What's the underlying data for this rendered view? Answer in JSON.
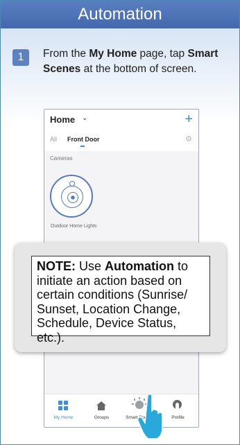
{
  "header": {
    "title": "Automation"
  },
  "step": {
    "number": "1",
    "text_1": "From the ",
    "bold_1": "My Home",
    "text_2": " page, tap ",
    "bold_2": "Smart Scenes",
    "text_3": " at the bottom of screen."
  },
  "phone": {
    "home_title": "Home",
    "chevron_icon": "chevron-down-icon",
    "add_icon": "+",
    "tabs": [
      "All",
      "Front Door"
    ],
    "settings_icon": "gear-icon",
    "section_label": "Cameras",
    "device": {
      "name": "Outdoor Home Lights",
      "icon": "camera-icon"
    },
    "nav": [
      {
        "label": "My Home",
        "icon": "grid-icon",
        "active": true
      },
      {
        "label": "Groups",
        "icon": "house-icon"
      },
      {
        "label": "Smart Scenes",
        "icon": "sun-icon"
      },
      {
        "label": "Profile",
        "icon": "profile-icon"
      }
    ]
  },
  "note": {
    "lead": "NOTE:",
    "text_1": " Use ",
    "bold": "Automation",
    "text_2": " to initiate an action based on certain conditions (Sunrise/ Sunset, Location Change, Schedule, Device Status, etc.)."
  },
  "colors": {
    "header_bg": "#4f74b8",
    "accent_blue": "#3f8ed8",
    "device_ring": "#5578c4",
    "pointer": "#29a8dc"
  }
}
